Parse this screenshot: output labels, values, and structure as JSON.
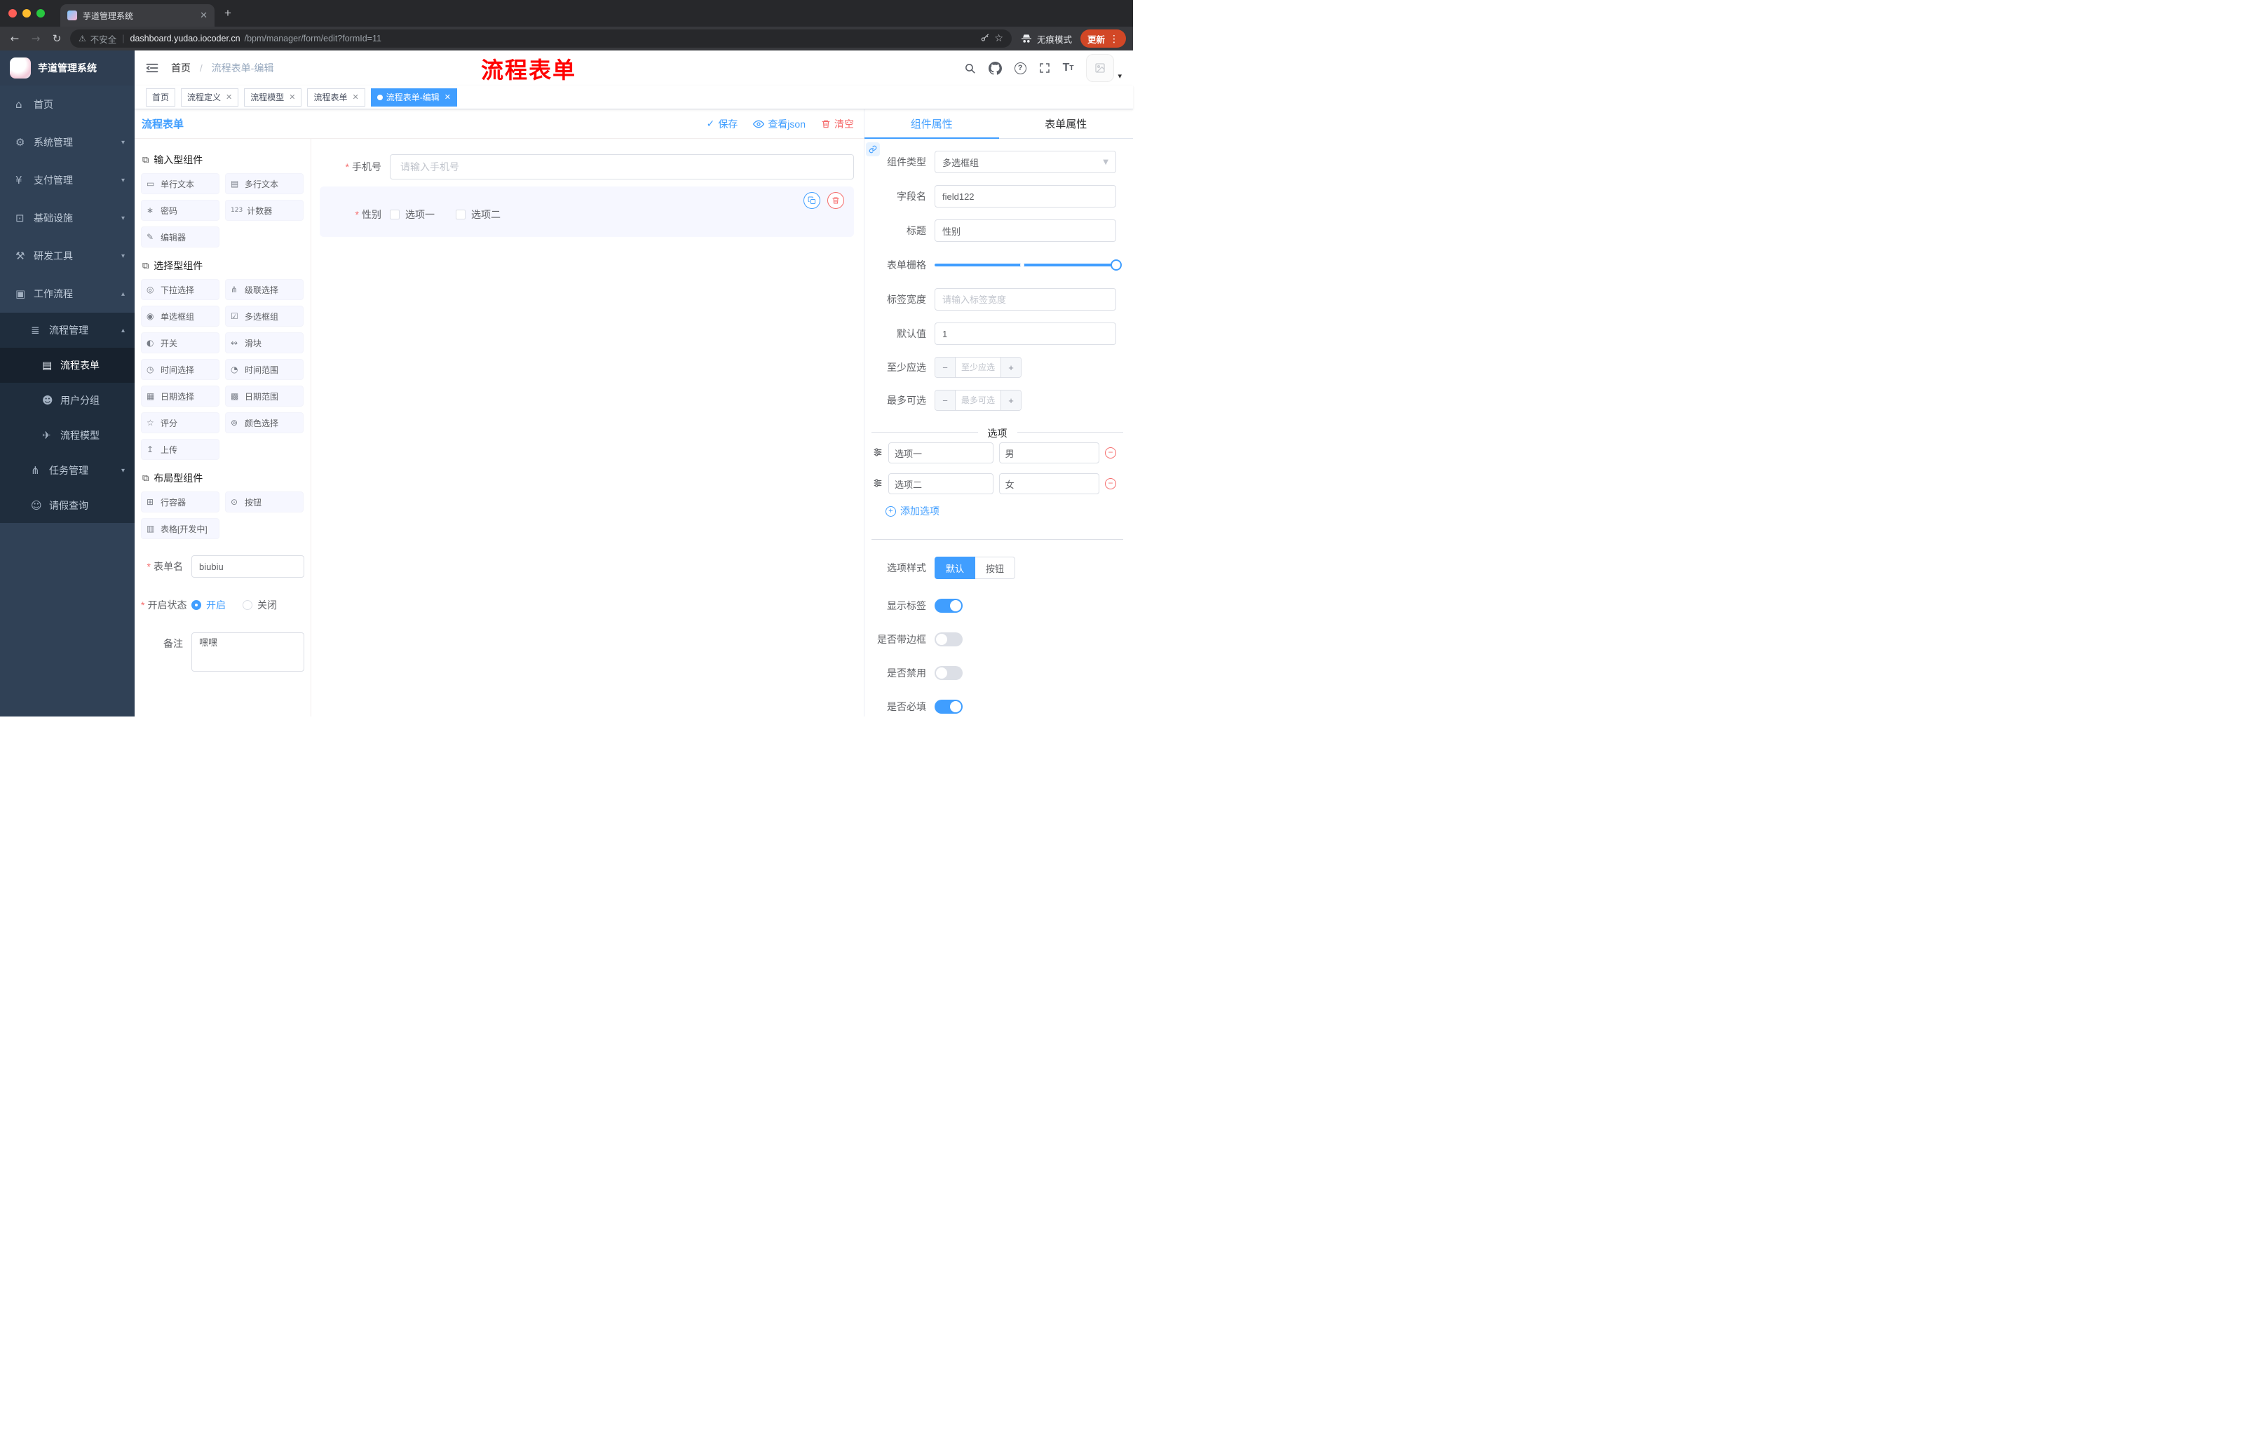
{
  "browser": {
    "tab_title": "芋道管理系统",
    "not_secure": "不安全",
    "url_domain": "dashboard.yudao.iocoder.cn",
    "url_path": "/bpm/manager/form/edit?formId=11",
    "incognito_label": "无痕模式",
    "update_label": "更新"
  },
  "sidebar": {
    "logo_title": "芋道管理系统",
    "items": [
      {
        "icon": "⌂",
        "label": "首页"
      },
      {
        "icon": "⚙",
        "label": "系统管理"
      },
      {
        "icon": "¥",
        "label": "支付管理"
      },
      {
        "icon": "⊡",
        "label": "基础设施"
      },
      {
        "icon": "⚒",
        "label": "研发工具"
      },
      {
        "icon": "▣",
        "label": "工作流程"
      },
      {
        "icon": "≣",
        "label": "流程管理"
      },
      {
        "icon": "▤",
        "label": "流程表单"
      },
      {
        "icon": "☻",
        "label": "用户分组"
      },
      {
        "icon": "✈",
        "label": "流程模型"
      },
      {
        "icon": "⋔",
        "label": "任务管理"
      },
      {
        "icon": "☺",
        "label": "请假查询"
      }
    ]
  },
  "navbar": {
    "breadcrumb_home": "首页",
    "breadcrumb_current": "流程表单-编辑",
    "annotation": "流程表单"
  },
  "tags": [
    {
      "label": "首页"
    },
    {
      "label": "流程定义"
    },
    {
      "label": "流程模型"
    },
    {
      "label": "流程表单"
    },
    {
      "label": "流程表单-编辑"
    }
  ],
  "editor": {
    "title": "流程表单",
    "save": "保存",
    "view_json": "查看json",
    "clear": "清空",
    "palette": {
      "sections": [
        {
          "title": "输入型组件",
          "items": [
            {
              "icon": "▭",
              "label": "单行文本"
            },
            {
              "icon": "▤",
              "label": "多行文本"
            },
            {
              "icon": "∗",
              "label": "密码"
            },
            {
              "icon": "123",
              "label": "计数器"
            },
            {
              "icon": "✎",
              "label": "编辑器"
            }
          ]
        },
        {
          "title": "选择型组件",
          "items": [
            {
              "icon": "◎",
              "label": "下拉选择"
            },
            {
              "icon": "⋔",
              "label": "级联选择"
            },
            {
              "icon": "◉",
              "label": "单选框组"
            },
            {
              "icon": "☑",
              "label": "多选框组"
            },
            {
              "icon": "◐",
              "label": "开关"
            },
            {
              "icon": "↭",
              "label": "滑块"
            },
            {
              "icon": "◷",
              "label": "时间选择"
            },
            {
              "icon": "◔",
              "label": "时间范围"
            },
            {
              "icon": "▦",
              "label": "日期选择"
            },
            {
              "icon": "▩",
              "label": "日期范围"
            },
            {
              "icon": "☆",
              "label": "评分"
            },
            {
              "icon": "⊚",
              "label": "颜色选择"
            },
            {
              "icon": "↥",
              "label": "上传"
            }
          ]
        },
        {
          "title": "布局型组件",
          "items": [
            {
              "icon": "⊞",
              "label": "行容器"
            },
            {
              "icon": "⊙",
              "label": "按钮"
            },
            {
              "icon": "▥",
              "label": "表格[开发中]"
            }
          ]
        }
      ]
    },
    "form_config": {
      "name_label": "表单名",
      "name_value": "biubiu",
      "status_label": "开启状态",
      "status_on": "开启",
      "status_off": "关闭",
      "remark_label": "备注",
      "remark_value": "嘿嘿"
    },
    "canvas": {
      "phone_label": "手机号",
      "phone_placeholder": "请输入手机号",
      "gender_label": "性别",
      "gender_options": [
        "选项一",
        "选项二"
      ]
    }
  },
  "props": {
    "tab_component": "组件属性",
    "tab_form": "表单属性",
    "component_type_label": "组件类型",
    "component_type_value": "多选框组",
    "field_name_label": "字段名",
    "field_name_value": "field122",
    "title_label": "标题",
    "title_value": "性别",
    "grid_label": "表单栅格",
    "label_width_label": "标签宽度",
    "label_width_placeholder": "请输入标签宽度",
    "default_label": "默认值",
    "default_value": "1",
    "min_label": "至少应选",
    "min_placeholder": "至少应选",
    "max_label": "最多可选",
    "max_placeholder": "最多可选",
    "options_title": "选项",
    "options": [
      {
        "label": "选项一",
        "value": "男"
      },
      {
        "label": "选项二",
        "value": "女"
      }
    ],
    "add_option": "添加选项",
    "option_style_label": "选项样式",
    "style_default": "默认",
    "style_button": "按钮",
    "switch_show_label": "显示标签",
    "switch_border": "是否带边框",
    "switch_disabled": "是否禁用",
    "switch_required": "是否必填"
  },
  "colors": {
    "accent": "#409EFF",
    "danger": "#F56C6C",
    "annotation": "#FF0000",
    "sidebar_bg": "#304156",
    "submenu_bg": "#1F2D3D",
    "update_button": "#D24726"
  }
}
